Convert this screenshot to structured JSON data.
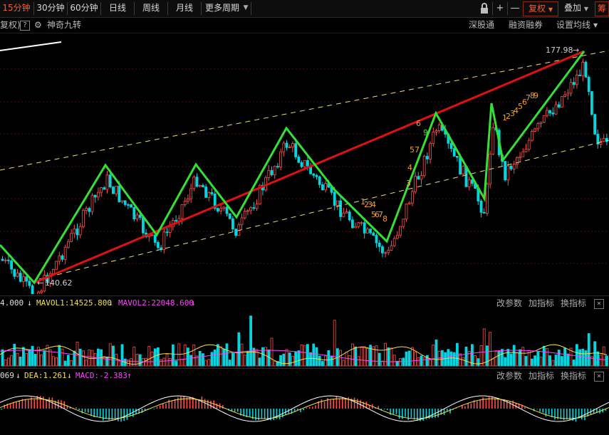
{
  "toolbar": {
    "tabs": [
      {
        "label": "15分钟",
        "active": true
      },
      {
        "label": "30分钟",
        "active": false
      },
      {
        "label": "60分钟",
        "active": false
      },
      {
        "label": "日线",
        "active": false
      },
      {
        "label": "周线",
        "active": false
      },
      {
        "label": "月线",
        "active": false
      },
      {
        "label": "更多周期",
        "active": false
      }
    ],
    "lock_icon": "lock-icon",
    "plus": "+",
    "minus": "—",
    "fuquan": "复权",
    "diejia": "叠加",
    "cut_label": "筹"
  },
  "subbar": {
    "left_cut": "复权)",
    "help": "?",
    "indicator": "神奇九转",
    "shengutong": "深股通",
    "rongzi": "融资融券",
    "settings": "设置均线"
  },
  "main_chart": {
    "high_label": "177.98",
    "low_label": "140.62",
    "td_labels": [
      "9",
      "6",
      "7",
      "5",
      "4",
      "3",
      "1",
      "2",
      "3",
      "4",
      "5",
      "6",
      "7",
      "8",
      "1",
      "2",
      "3",
      "4",
      "5",
      "6",
      "7",
      "8",
      "9"
    ]
  },
  "volume_panel": {
    "vol_value": "4.000",
    "mavol1": "MAVOL1:14525.800",
    "mavol2": "MAVOL2:22048.600",
    "btn_params": "改参数",
    "btn_add": "加指标",
    "btn_switch": "换指标",
    "close": "×"
  },
  "macd_panel": {
    "diff_value": "069",
    "dea": "DEA:1.261",
    "macd": "MACD:-2.383",
    "btn_params": "改参数",
    "btn_add": "加指标",
    "btn_switch": "换指标",
    "close": "×"
  },
  "colors": {
    "up": "#ff4d4d",
    "down": "#00d6e0",
    "zigzag": "#33e033",
    "trend": "#e01010",
    "channel": "#e8e070",
    "accent": "#ff5a2a"
  }
}
